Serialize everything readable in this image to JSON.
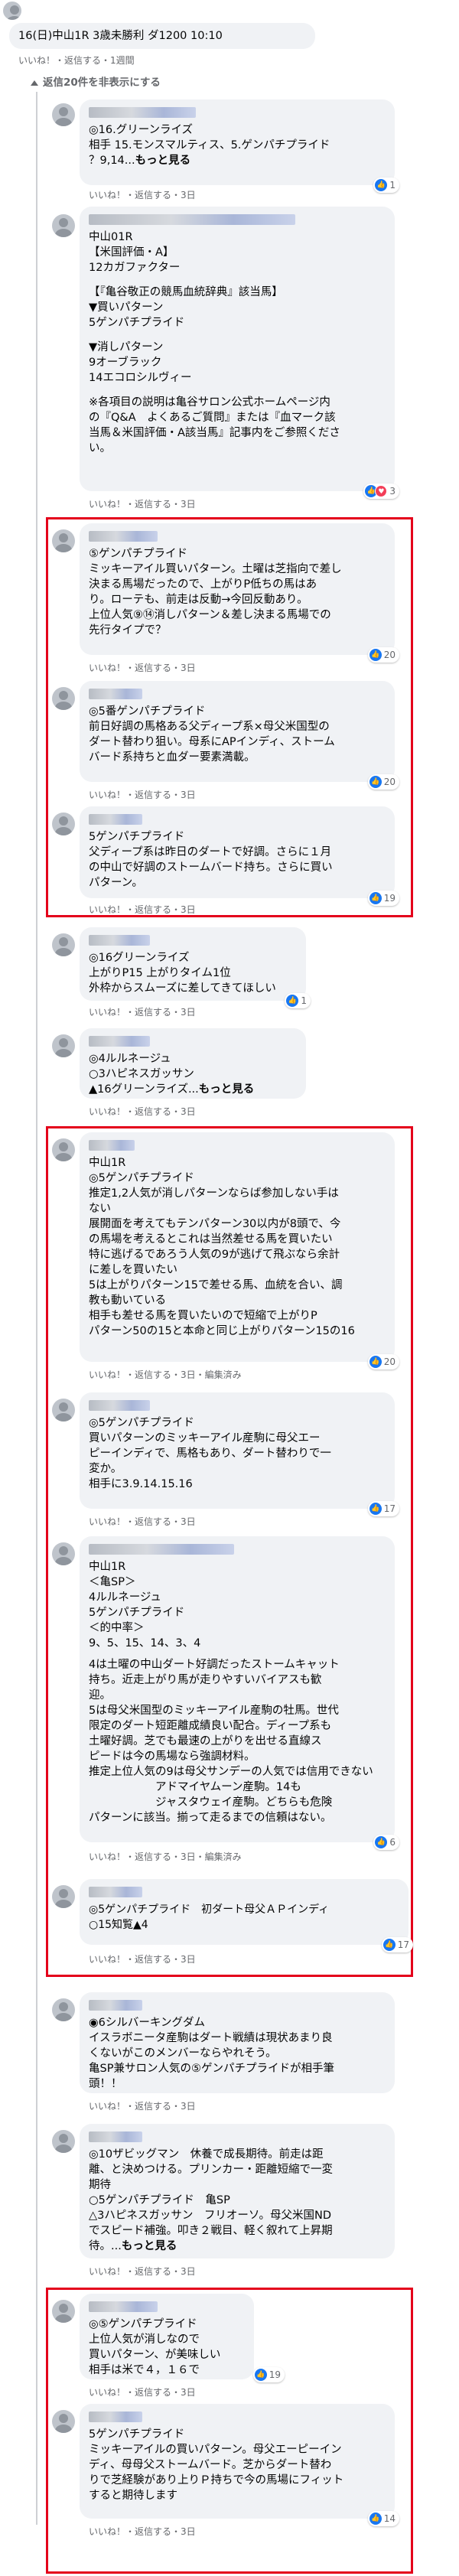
{
  "post": {
    "title": "16(日)中山1R 3歳未勝利 ダ1200 10:10",
    "actions": "いいね！・返信する・1週間",
    "hide_replies": "返信20件を非表示にする"
  },
  "comments": [
    {
      "lines": [
        "◎16.グリーンライズ",
        "相手 15.モンスマルティス、5.ゲンパチプライド",
        "？9,14..."
      ],
      "more": "もっと見る",
      "likes": "1",
      "actions": "いいね！・返信する・3日"
    },
    {
      "lines": [
        "中山01R",
        "【米国評価・A】",
        "12カガファクター",
        "",
        "【『亀谷敬正の競馬血統辞典』該当馬】",
        "▼買いパターン",
        "5ゲンパチプライド",
        "",
        "▼消しパターン",
        "9オーブラック",
        "14エコロシルヴィー",
        "",
        "※各項目の説明は亀谷サロン公式ホームページ内",
        "の『Q&A　よくあるご質問』または『血マーク該",
        "当馬＆米国評価・A該当馬』記事内をご参照くださ",
        "い。"
      ],
      "likes": "3",
      "actions": "いいね！・返信する・3日"
    },
    {
      "lines": [
        "⑤ゲンパチプライド",
        "ミッキーアイル買いパターン。土曜は芝指向で差し",
        "決まる馬場だったので、上がりP低ちの馬はあ",
        "り。ローテも、前走は反動→今回反動あり。",
        "上位人気⑨⑭消しパターン＆差し決まる馬場での",
        "先行タイプで？"
      ],
      "likes": "20",
      "actions": "いいね！・返信する・3日"
    },
    {
      "lines": [
        "◎5番ゲンパチプライド",
        "前日好調の馬格ある父ディープ系×母父米国型の",
        "ダート替わり狙い。母系にAPインディ、ストーム",
        "バード系持ちと血ダー要素満載。"
      ],
      "likes": "20",
      "actions": "いいね！・返信する・3日"
    },
    {
      "lines": [
        "5ゲンパチプライド",
        "父ディープ系は昨日のダートで好調。さらに１月",
        "の中山で好調のストームバード持ち。さらに買い",
        "パターン。"
      ],
      "likes": "19",
      "actions": "いいね！・返信する・3日"
    },
    {
      "lines": [
        "◎16グリーンライズ",
        "上がりP15 上がりタイム1位",
        "外枠からスムーズに差してきてほしい"
      ],
      "likes": "1",
      "actions": "いいね！・返信する・3日"
    },
    {
      "lines": [
        "◎4ルルネージュ",
        "○3ハピネスガッサン",
        "▲16グリーンライズ..."
      ],
      "more": "もっと見る",
      "actions": "いいね！・返信する・3日"
    },
    {
      "lines": [
        "中山1R",
        "◎5ゲンパチプライド",
        "推定1,2人気が消しパターンならば参加しない手は",
        "ない",
        "展開面を考えてもテンパターン30以内が8頭で、今",
        "の馬場を考えるとこれは当然差せる馬を買いたい",
        "特に逃げるであろう人気の9が逃げて飛ぶなら余計",
        "に差しを買いたい",
        "5は上がりパターン15で差せる馬、血統を合い、調",
        "教も動いている",
        "相手も差せる馬を買いたいので短縮で上がりP",
        "パターン50の15と本命と同じ上がりパターン15の16"
      ],
      "likes": "20",
      "actions": "いいね！・返信する・3日・編集済み"
    },
    {
      "lines": [
        "◎5ゲンパチプライド",
        "買いパターンのミッキーアイル産駒に母父エー",
        "ピーインディで、馬格もあり、ダート替わりで一",
        "変か。",
        "相手に3.9.14.15.16"
      ],
      "likes": "17",
      "actions": "いいね！・返信する・3日"
    },
    {
      "lines": [
        "中山1R",
        "＜亀SP＞",
        "4ルルネージュ",
        "5ゲンパチプライド",
        "＜的中率＞",
        "9、5、15、14、3、4",
        "",
        "4は土曜の中山ダート好調だったストームキャット",
        "持ち。近走上がり馬が走りやすいバイアスも歓",
        "迎。",
        "5は母父米国型のミッキーアイル産駒の牡馬。世代",
        "限定のダート短距離成績良い配合。ディープ系も",
        "土曜好調。芝でも最速の上がりを出せる直線ス",
        "ピードは今の馬場なら強調材料。",
        "推定上位人気の9は母父サンデーの人気では信用できない",
        "　　　　　　アドマイヤムーン産駒。14も",
        "　　　　　　ジャスタウェイ産駒。どちらも危険",
        "パターンに該当。揃って走るまでの信頼はない。"
      ],
      "likes": "6",
      "actions": "いいね！・返信する・3日・編集済み"
    },
    {
      "lines": [
        "◎5ゲンパチプライド　初ダート母父ＡＰインディ",
        "○15知覧▲4"
      ],
      "likes": "17",
      "actions": "いいね！・返信する・3日"
    },
    {
      "lines": [
        "◉6シルバーキングダム",
        "イスラボニータ産駒はダート戦績は現状あまり良",
        "くないがこのメンバーならやれそう。",
        "亀SP兼サロン人気の⑤ゲンパチプライドが相手筆",
        "頭！！"
      ],
      "actions": "いいね！・返信する・3日"
    },
    {
      "lines": [
        "◎10ザビッグマン　休養で成長期待。前走は距",
        "離、と決めつける。プリンカー・距離短縮で一変",
        "期待",
        "○5ゲンパチプライド　亀SP",
        "△3ハピネスガッサン　フリオーソ。母父米国ND",
        "でスピード補強。叩き２戦目、軽く叙れて上昇期",
        "待。..."
      ],
      "more": "もっと見る",
      "actions": "いいね！・返信する・3日"
    },
    {
      "lines": [
        "◎⑤ゲンパチプライド",
        "上位人気が消しなので",
        "買いパターン、が美味しい",
        "相手は米で４，１６で"
      ],
      "likes": "19",
      "actions": "いいね！・返信する・3日"
    },
    {
      "lines": [
        "5ゲンパチプライド",
        "ミッキーアイルの買いパターン。母父エーピーイン",
        "ディ、母母父ストームバード。芝からダート替わ",
        "りで芝経験があり上りＰ持ちで今の馬場にフィット",
        "すると期待します"
      ],
      "likes": "14",
      "actions": "いいね！・返信する・3日"
    }
  ],
  "colors": {
    "highlight": "#e4001b",
    "like": "#1877f2",
    "heart": "#f33e58",
    "bubble": "#f0f2f5"
  }
}
